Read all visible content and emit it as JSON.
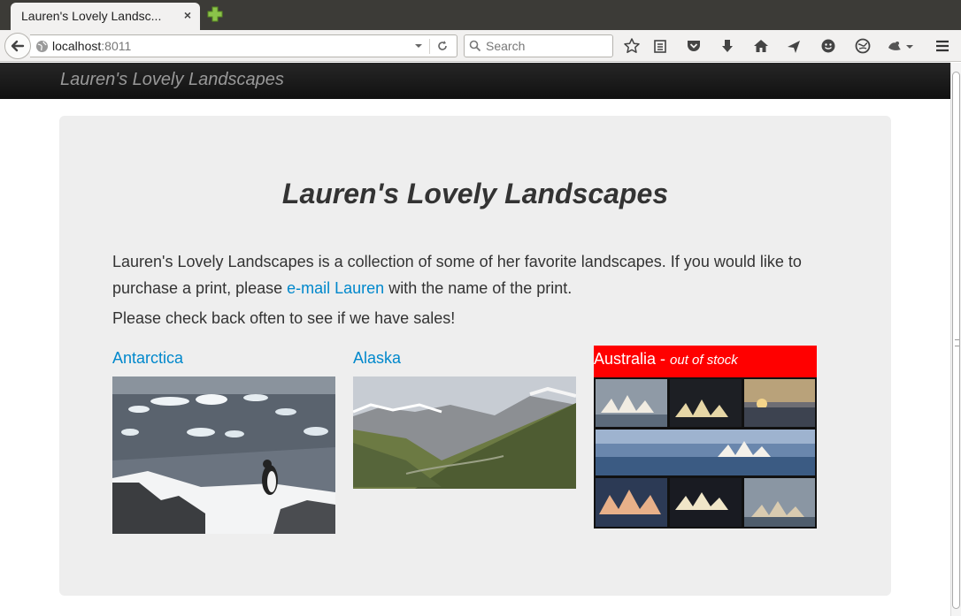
{
  "browser": {
    "tab_title": "Lauren's Lovely Landsc...",
    "tab_close": "×",
    "url_host": "localhost",
    "url_port": ":8011",
    "search_placeholder": "Search"
  },
  "site": {
    "brand": "Lauren's Lovely Landscapes",
    "title": "Lauren's Lovely Landscapes",
    "intro_before": "Lauren's Lovely Landscapes is a collection of some of her favorite landscapes. If you would like to purchase a print, please ",
    "email_link": "e-mail Lauren",
    "intro_after": " with the name of the print.",
    "sales_note": "Please check back often to see if we have sales!"
  },
  "products": [
    {
      "name": "Antarctica"
    },
    {
      "name": "Alaska"
    },
    {
      "name": "Australia",
      "separator": " - ",
      "status": "out of stock",
      "status_color": "#ff0000"
    }
  ],
  "colors": {
    "link": "#0088cc",
    "nav_bg": "#1b1b1b",
    "hero_bg": "#eeeeee"
  }
}
